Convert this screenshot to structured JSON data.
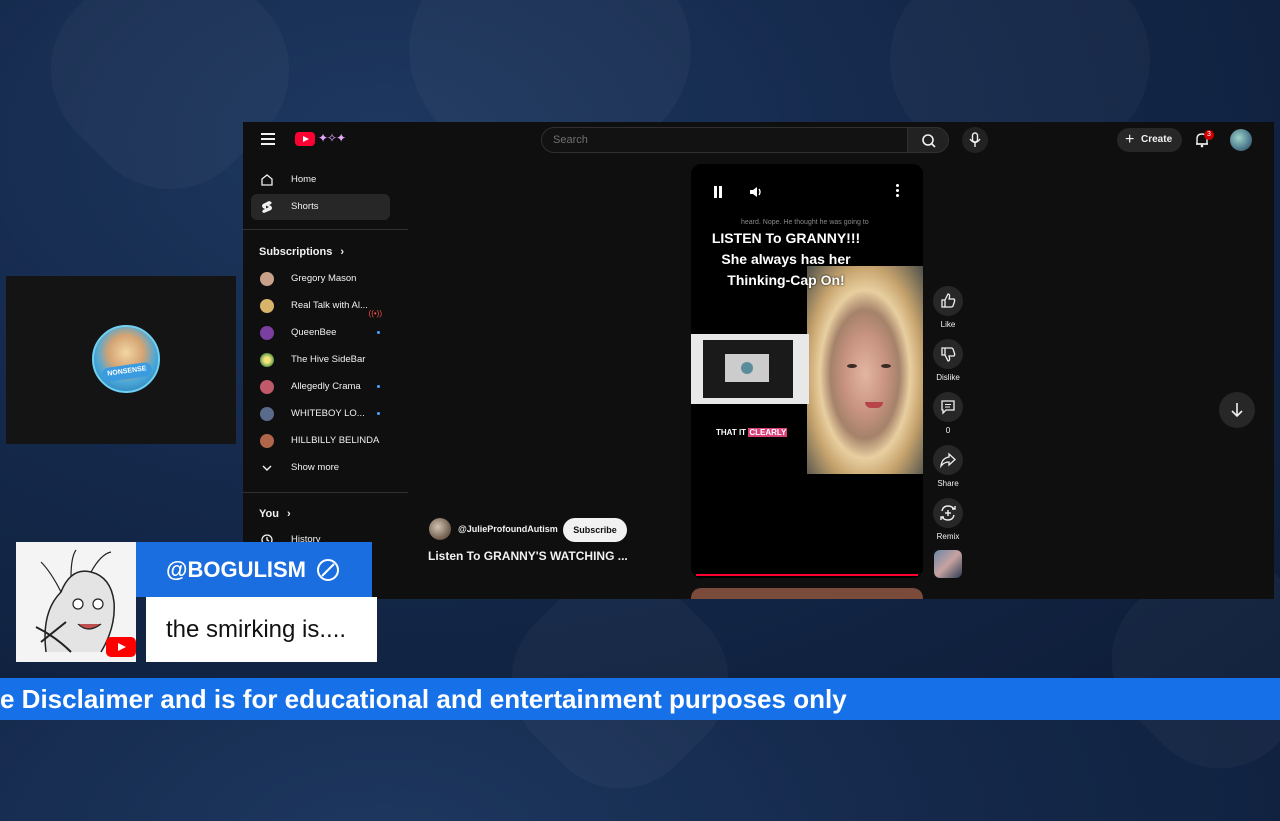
{
  "topbar": {
    "search_placeholder": "Search",
    "create_label": "Create",
    "notification_count": "3"
  },
  "sidebar": {
    "nav": [
      {
        "label": "Home",
        "icon": "home-icon"
      },
      {
        "label": "Shorts",
        "icon": "shorts-icon"
      }
    ],
    "subscriptions_heading": "Subscriptions",
    "subscriptions": [
      {
        "label": "Gregory Mason",
        "indicator": ""
      },
      {
        "label": "Real Talk with Al...",
        "indicator": "live"
      },
      {
        "label": "QueenBee",
        "indicator": "new"
      },
      {
        "label": "The Hive SideBar",
        "indicator": ""
      },
      {
        "label": "Allegedly Crama",
        "indicator": "new"
      },
      {
        "label": "WHITEBOY LO...",
        "indicator": "new"
      },
      {
        "label": "HILLBILLY BELINDA",
        "indicator": ""
      }
    ],
    "show_more": "Show more",
    "you_heading": "You",
    "history_label": "History"
  },
  "short": {
    "overlay_small_text": "heard. Nope. He thought he was going to",
    "overlay_title_line1": "LISTEN To GRANNY!!!",
    "overlay_title_line2": "She always has her",
    "overlay_title_line3": "Thinking-Cap On!",
    "caption_prefix": "THAT IT",
    "caption_highlight": "CLEARLY",
    "channel_handle": "@JulieProfoundAutism",
    "subscribe_label": "Subscribe",
    "title": "Listen To GRANNY'S WATCHING ..."
  },
  "actions": {
    "like": "Like",
    "dislike": "Dislike",
    "comments": "0",
    "share": "Share",
    "remix": "Remix"
  },
  "cam": {
    "badge_text": "NONSENSE"
  },
  "chat": {
    "username": "@BOGULISM",
    "message": "the smirking is...."
  },
  "ticker": {
    "text": "e Disclaimer and is for educational and entertainment purposes only"
  },
  "colors": {
    "accent": "#ff0033",
    "chat_name_bg": "#1a6ee0",
    "ticker_bg": "#1670e8"
  }
}
